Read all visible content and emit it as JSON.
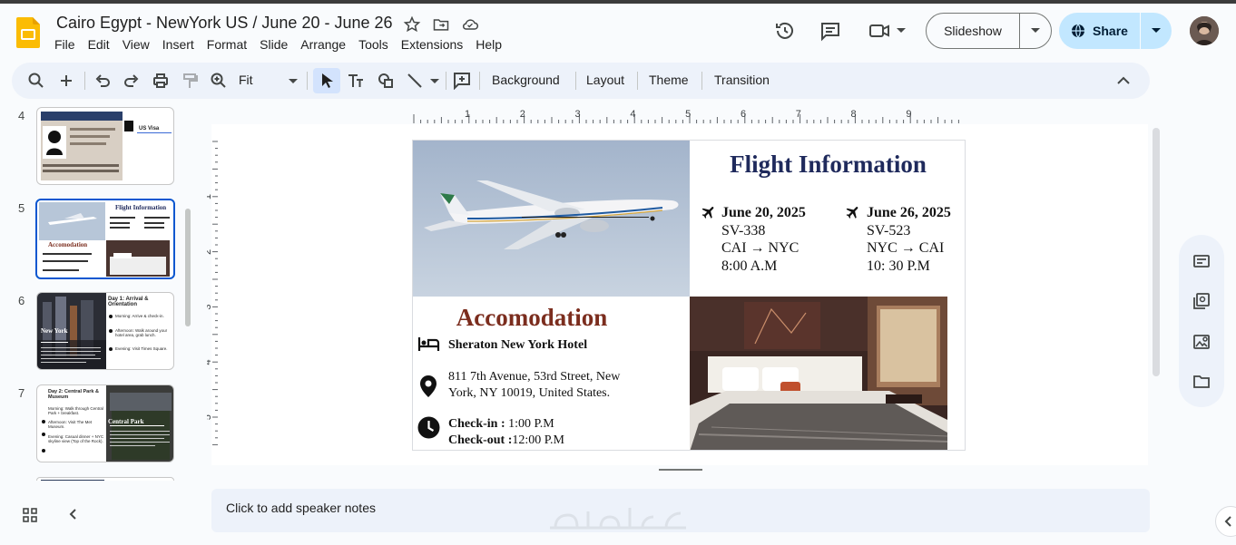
{
  "app": {
    "title": "Cairo Egypt - NewYork US / June 20 - June 26",
    "menu": [
      "File",
      "Edit",
      "View",
      "Insert",
      "Format",
      "Slide",
      "Arrange",
      "Tools",
      "Extensions",
      "Help"
    ],
    "slideshow_label": "Slideshow",
    "share_label": "Share"
  },
  "toolbar": {
    "zoom": "Fit",
    "background": "Background",
    "layout": "Layout",
    "theme": "Theme",
    "transition": "Transition"
  },
  "ruler": {
    "horizontal": [
      "1",
      "2",
      "3",
      "4",
      "5",
      "6",
      "7",
      "8",
      "9"
    ],
    "vertical": [
      "1",
      "2",
      "3",
      "4",
      "5"
    ]
  },
  "filmstrip": {
    "numbers": [
      "4",
      "5",
      "6",
      "7"
    ],
    "slide4": {
      "label": "US Visa"
    },
    "slide5": {
      "title": "Flight Information",
      "accom": "Accomodation"
    },
    "slide6": {
      "title": "Day 1: Arrival & Orientation",
      "city": "New York",
      "items": [
        "Morning: Arrive & check-in.",
        "Afternoon: Walk around your hotel area, grab lunch.",
        "Evening: Visit Times Square."
      ]
    },
    "slide7": {
      "title": "Day 2: Central Park & Museum",
      "city": "Central Park",
      "items": [
        "Morning: Walk through Central Park + breakfast.",
        "Afternoon: Visit The Met Museum.",
        "Evening: Casual dinner + NYC skyline view (Top of the Rock)."
      ]
    }
  },
  "slide": {
    "flight_title": "Flight Information",
    "outbound": {
      "date": "June 20, 2025",
      "flight": "SV-338",
      "route": "CAI → NYC",
      "time": "8:00 A.M"
    },
    "return": {
      "date": "June 26, 2025",
      "flight": "SV-523",
      "route": "NYC → CAI",
      "time": "10: 30 P.M"
    },
    "accom_title": "Accomodation",
    "hotel": "Sheraton New York Hotel",
    "address1": "811 7th Avenue, 53rd Street, New",
    "address2": "York, NY 10019, United States.",
    "checkin_label": "Check-in :",
    "checkin_time": " 1:00 P.M",
    "checkout_label": "Check-out :",
    "checkout_time": "12:00 P.M"
  },
  "notes": {
    "placeholder": "Click to add speaker notes"
  },
  "colors": {
    "title_navy": "#1f2a5c",
    "accom_brown": "#7b2d1e",
    "accent_blue": "#0b57d0",
    "share_bg": "#c2e7ff"
  }
}
